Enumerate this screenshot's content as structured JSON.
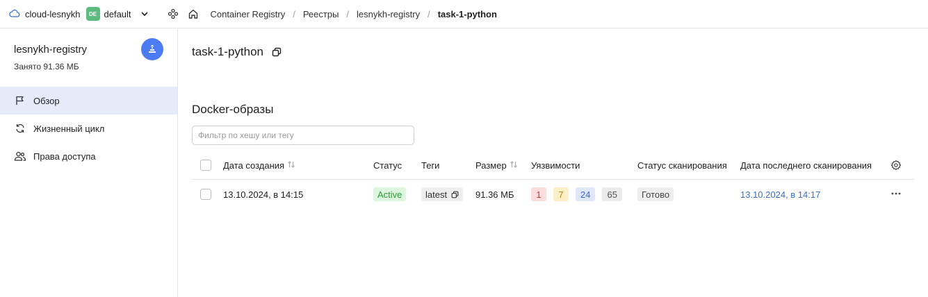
{
  "topbar": {
    "cloud_name": "cloud-lesnykh",
    "folder_badge": "DE",
    "folder_name": "default",
    "breadcrumbs": [
      "Container Registry",
      "Реестры",
      "lesnykh-registry"
    ],
    "breadcrumb_current": "task-1-python",
    "separator": "/"
  },
  "sidebar": {
    "registry_name": "lesnykh-registry",
    "used_label": "Занято 91.36 МБ",
    "items": [
      {
        "label": "Обзор",
        "icon": "flag-icon",
        "active": true
      },
      {
        "label": "Жизненный цикл",
        "icon": "refresh-icon",
        "active": false
      },
      {
        "label": "Права доступа",
        "icon": "users-icon",
        "active": false
      }
    ]
  },
  "main": {
    "title": "task-1-python",
    "section_title": "Docker-образы",
    "filter_placeholder": "Фильтр по хешу или тегу",
    "columns": {
      "created": "Дата создания",
      "status": "Статус",
      "tags": "Теги",
      "size": "Размер",
      "vulns": "Уязвимости",
      "scan_status": "Статус сканирования",
      "last_scan": "Дата последнего сканирования"
    },
    "rows": [
      {
        "created": "13.10.2024, в 14:15",
        "status": "Active",
        "tag": "latest",
        "size": "91.36 МБ",
        "vulns": {
          "critical": "1",
          "medium": "7",
          "low": "24",
          "negligible": "65"
        },
        "scan_status": "Готово",
        "last_scan": "13.10.2024, в 14:17"
      }
    ]
  },
  "colors": {
    "accent": "#4c7cf3",
    "active_nav": "#e6ebf9",
    "folder_badge": "#5dbb7f",
    "link": "#3b6ecc"
  }
}
